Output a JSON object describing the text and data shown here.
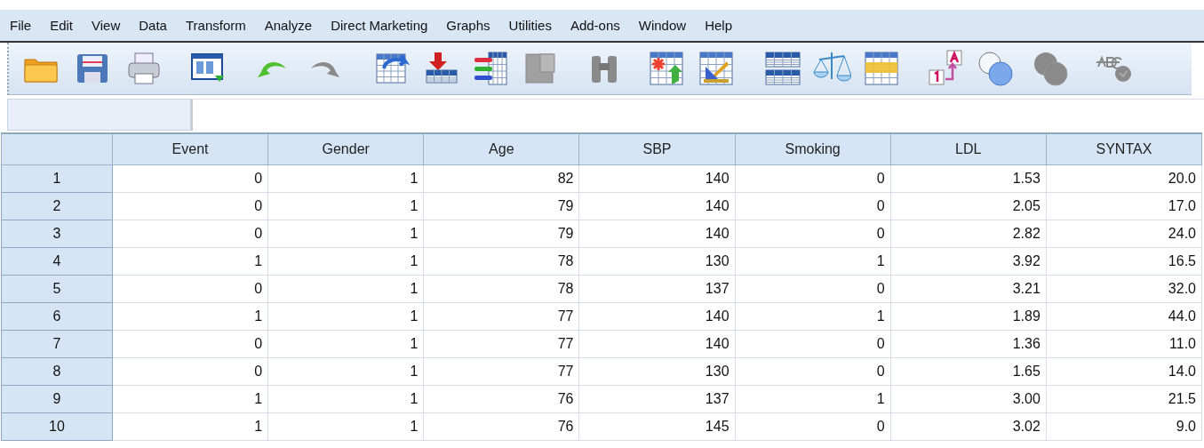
{
  "menu": [
    "File",
    "Edit",
    "View",
    "Data",
    "Transform",
    "Analyze",
    "Direct Marketing",
    "Graphs",
    "Utilities",
    "Add-ons",
    "Window",
    "Help"
  ],
  "table": {
    "columns": [
      "Event",
      "Gender",
      "Age",
      "SBP",
      "Smoking",
      "LDL",
      "SYNTAX"
    ],
    "rows": [
      {
        "number": "1",
        "cells": [
          "0",
          "1",
          "82",
          "140",
          "0",
          "1.53",
          "20.0"
        ]
      },
      {
        "number": "2",
        "cells": [
          "0",
          "1",
          "79",
          "140",
          "0",
          "2.05",
          "17.0"
        ]
      },
      {
        "number": "3",
        "cells": [
          "0",
          "1",
          "79",
          "140",
          "0",
          "2.82",
          "24.0"
        ]
      },
      {
        "number": "4",
        "cells": [
          "1",
          "1",
          "78",
          "130",
          "1",
          "3.92",
          "16.5"
        ]
      },
      {
        "number": "5",
        "cells": [
          "0",
          "1",
          "78",
          "137",
          "0",
          "3.21",
          "32.0"
        ]
      },
      {
        "number": "6",
        "cells": [
          "1",
          "1",
          "77",
          "140",
          "1",
          "1.89",
          "44.0"
        ]
      },
      {
        "number": "7",
        "cells": [
          "0",
          "1",
          "77",
          "140",
          "0",
          "1.36",
          "11.0"
        ]
      },
      {
        "number": "8",
        "cells": [
          "0",
          "1",
          "77",
          "130",
          "0",
          "1.65",
          "14.0"
        ]
      },
      {
        "number": "9",
        "cells": [
          "1",
          "1",
          "76",
          "137",
          "1",
          "3.00",
          "21.5"
        ]
      },
      {
        "number": "10",
        "cells": [
          "1",
          "1",
          "76",
          "145",
          "0",
          "3.02",
          "9.0"
        ]
      }
    ]
  }
}
